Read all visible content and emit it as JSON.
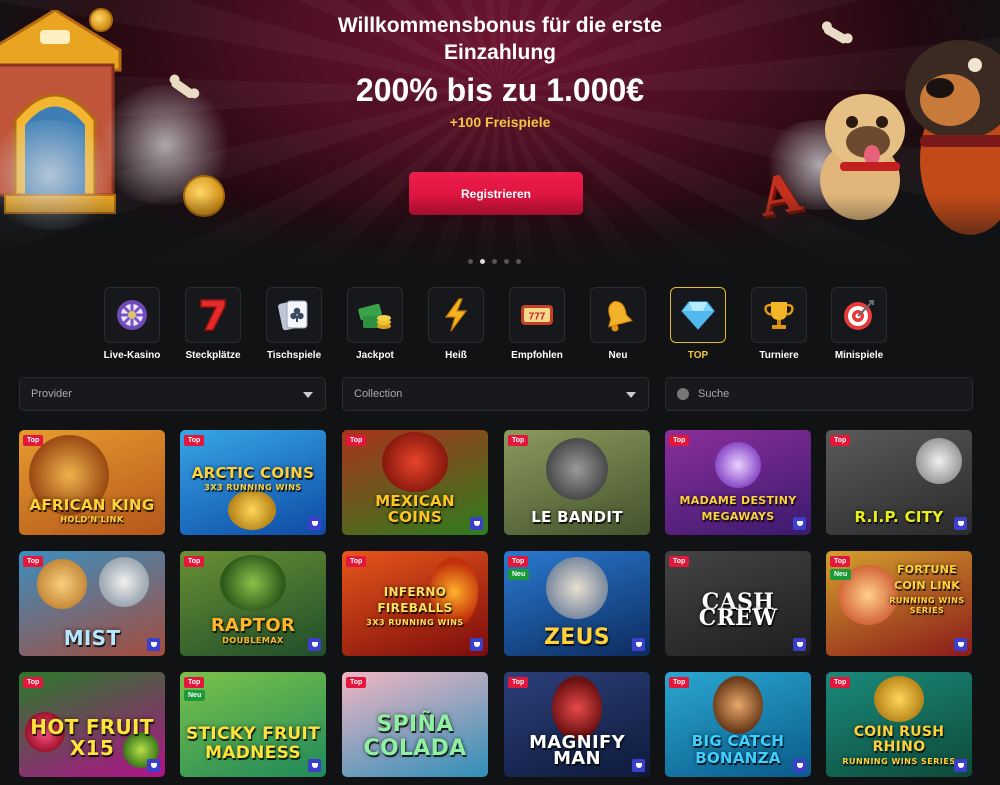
{
  "hero": {
    "title": "Willkommensbonus für die erste Einzahlung",
    "amount": "200% bis zu 1.000€",
    "free_spins": "+100 Freispiele",
    "register_label": "Registrieren",
    "slide_count": 5,
    "active_slide": 2
  },
  "categories": [
    {
      "label": "Live-Kasino",
      "icon": "roulette-wheel-icon"
    },
    {
      "label": "Steckplätze",
      "icon": "seven-icon"
    },
    {
      "label": "Tischspiele",
      "icon": "playing-card-icon"
    },
    {
      "label": "Jackpot",
      "icon": "money-stack-icon"
    },
    {
      "label": "Heiß",
      "icon": "lightning-icon"
    },
    {
      "label": "Empfohlen",
      "icon": "slot-777-icon"
    },
    {
      "label": "Neu",
      "icon": "bell-icon"
    },
    {
      "label": "TOP",
      "icon": "diamond-icon",
      "active": true
    },
    {
      "label": "Turniere",
      "icon": "trophy-icon"
    },
    {
      "label": "Minispiele",
      "icon": "target-icon"
    }
  ],
  "filters": {
    "provider_label": "Provider",
    "collection_label": "Collection",
    "search_placeholder": "Suche"
  },
  "badges": {
    "top": "Top",
    "new": "Neu"
  },
  "games": [
    {
      "title": "African King",
      "subtitle": "Hold'n'Link",
      "badges": [
        "Top"
      ],
      "trophy": false,
      "bg": "#b4571b",
      "bg2": "#e79b2e",
      "color": "#ffd23a"
    },
    {
      "title": "Arctic Coins",
      "subtitle": "3x3 Running Wins",
      "badges": [
        "Top"
      ],
      "trophy": true,
      "bg": "#0e4aa6",
      "bg2": "#37a6e6",
      "color": "#ffd23a"
    },
    {
      "title": "Mexican Coins",
      "subtitle": "",
      "badges": [
        "Top"
      ],
      "trophy": true,
      "bg": "#2e7d1f",
      "bg2": "#a8341c",
      "color": "#ffc61f"
    },
    {
      "title": "Le Bandit",
      "subtitle": "",
      "badges": [
        "Top"
      ],
      "trophy": false,
      "bg": "#43522c",
      "bg2": "#8c9a5d",
      "color": "#ffffff"
    },
    {
      "title": "Madame Destiny Megaways",
      "subtitle": "",
      "badges": [
        "Top"
      ],
      "trophy": true,
      "bg": "#3a1a6e",
      "bg2": "#8b2f9b",
      "color": "#ffd23a"
    },
    {
      "title": "R.I.P. City",
      "subtitle": "",
      "badges": [
        "Top"
      ],
      "trophy": true,
      "bg": "#2a2a2a",
      "bg2": "#5a5a5a",
      "color": "#e9ef1c"
    },
    {
      "title": "Mist",
      "subtitle": "",
      "badges": [
        "Top"
      ],
      "trophy": true,
      "bg": "#a44c3c",
      "bg2": "#3c8fc0",
      "color": "#b7e7ff"
    },
    {
      "title": "Raptor",
      "subtitle": "Doublemax",
      "badges": [
        "Top"
      ],
      "trophy": true,
      "bg": "#1f4e2a",
      "bg2": "#6a8f34",
      "color": "#ffb62a"
    },
    {
      "title": "Inferno Fireballs",
      "subtitle": "3x3 Running Wins",
      "badges": [
        "Top"
      ],
      "trophy": true,
      "bg": "#7a0c0c",
      "bg2": "#e8561a",
      "color": "#ffe05a"
    },
    {
      "title": "Zeus",
      "subtitle": "",
      "badges": [
        "Top",
        "Neu"
      ],
      "trophy": true,
      "bg": "#0c2b5e",
      "bg2": "#2a7ad1",
      "color": "#ffd23a"
    },
    {
      "title": "Cash Crew",
      "subtitle": "",
      "badges": [
        "Top"
      ],
      "trophy": true,
      "bg": "#1e1e1e",
      "bg2": "#444444",
      "color": "#ffffff"
    },
    {
      "title": "Fortune Coin Link",
      "subtitle": "Running Wins Series",
      "badges": [
        "Top",
        "Neu"
      ],
      "trophy": true,
      "bg": "#8a1a1a",
      "bg2": "#d4a02c",
      "color": "#ffd23a"
    },
    {
      "title": "Hot Fruit x15",
      "subtitle": "",
      "badges": [
        "Top"
      ],
      "trophy": true,
      "bg": "#b0128a",
      "bg2": "#2a7a2a",
      "color": "#ffe23a"
    },
    {
      "title": "Sticky Fruit Madness",
      "subtitle": "",
      "badges": [
        "Top",
        "Neu"
      ],
      "trophy": true,
      "bg": "#1f8a5a",
      "bg2": "#7cc24a",
      "color": "#ffe23a"
    },
    {
      "title": "Spiña Colada",
      "subtitle": "",
      "badges": [
        "Top"
      ],
      "trophy": false,
      "bg": "#2e8fb8",
      "bg2": "#f1b6c4",
      "color": "#8ef0a0"
    },
    {
      "title": "Magnify Man",
      "subtitle": "",
      "badges": [
        "Top"
      ],
      "trophy": true,
      "bg": "#0e1a3a",
      "bg2": "#2c3f7a",
      "color": "#ffffff"
    },
    {
      "title": "Big Catch Bonanza",
      "subtitle": "",
      "badges": [
        "Top"
      ],
      "trophy": true,
      "bg": "#0a5a8a",
      "bg2": "#2aa7d1",
      "color": "#3fd0ff"
    },
    {
      "title": "Coin Rush Rhino",
      "subtitle": "Running Wins Series",
      "badges": [
        "Top"
      ],
      "trophy": true,
      "bg": "#0e4a3a",
      "bg2": "#1a8a7a",
      "color": "#ffd23a"
    }
  ]
}
